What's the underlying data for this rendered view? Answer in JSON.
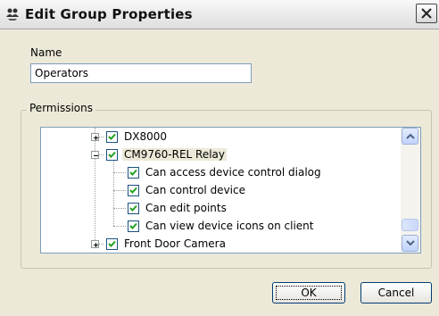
{
  "window": {
    "title": "Edit Group Properties",
    "title_icon": "group-settings-icon",
    "close_icon": "close-icon"
  },
  "name_field": {
    "label": "Name",
    "value": "Operators"
  },
  "permissions": {
    "legend": "Permissions",
    "items": [
      {
        "label": "DX8000",
        "checked": true,
        "expander": "plus"
      },
      {
        "label": "CM9760-REL Relay",
        "checked": true,
        "expander": "minus",
        "selected": true
      },
      {
        "label": "Can access device control dialog",
        "checked": true
      },
      {
        "label": "Can control device",
        "checked": true
      },
      {
        "label": "Can edit points",
        "checked": true
      },
      {
        "label": "Can view device icons on client",
        "checked": true
      },
      {
        "label": "Front Door Camera",
        "checked": true,
        "expander": "plus"
      }
    ]
  },
  "buttons": {
    "ok": "OK",
    "cancel": "Cancel"
  },
  "colors": {
    "dialog_bg": "#ece9d8",
    "field_border": "#7f9db9",
    "checkbox_border": "#1c5180",
    "check_mark": "#21a121"
  }
}
